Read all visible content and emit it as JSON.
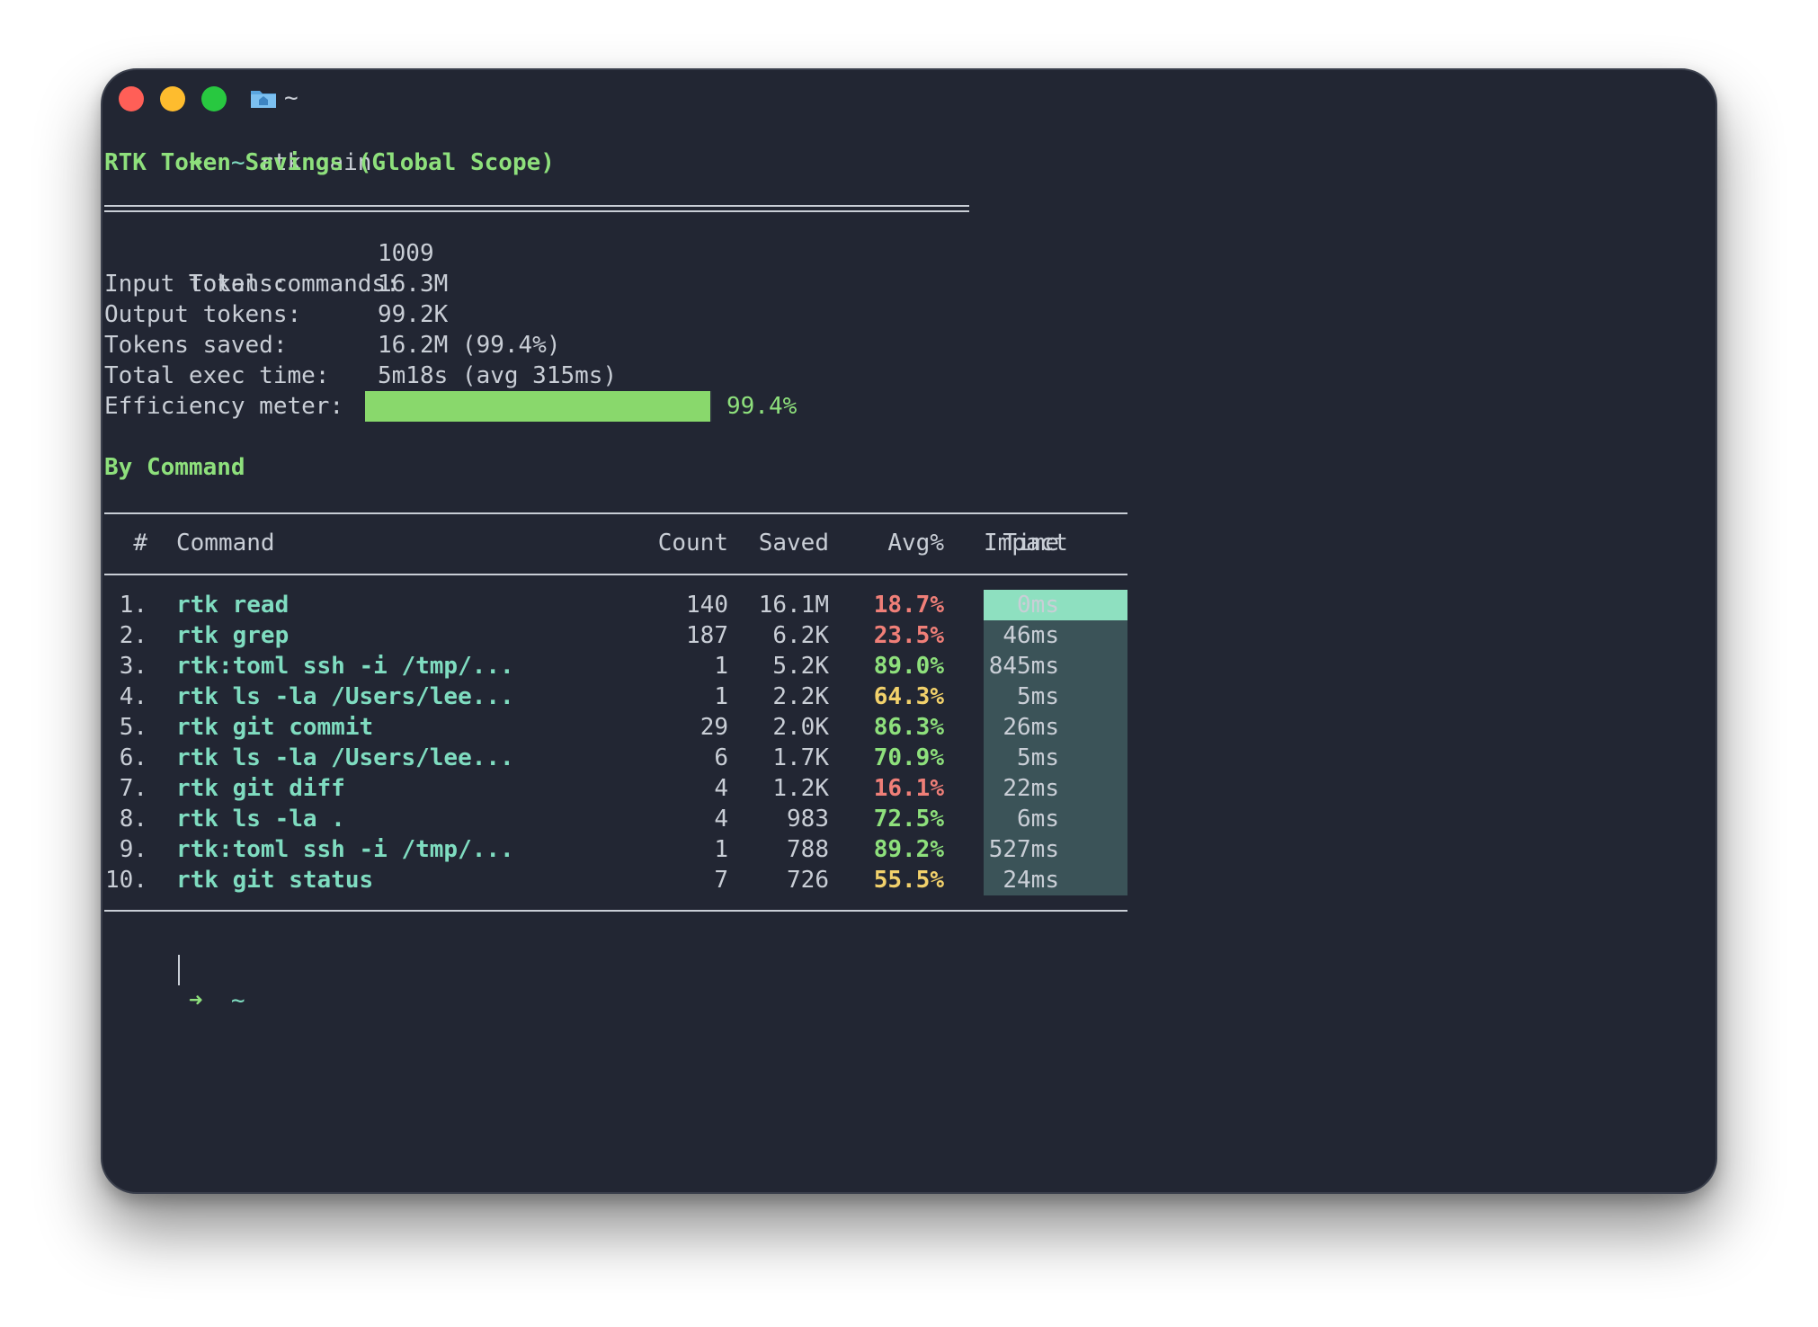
{
  "window": {
    "title": "~"
  },
  "terminal": {
    "prompt_arrow": "➜",
    "prompt_dir": "~",
    "command": "rtk gain",
    "heading": "RTK Token Savings (Global Scope)",
    "stats": [
      {
        "label": "Total commands:",
        "value": "1009"
      },
      {
        "label": "Input tokens:",
        "value": "16.3M"
      },
      {
        "label": "Output tokens:",
        "value": "99.2K"
      },
      {
        "label": "Tokens saved:",
        "value": "16.2M (99.4%)"
      },
      {
        "label": "Total exec time:",
        "value": "5m18s (avg 315ms)"
      }
    ],
    "meter": {
      "label": "Efficiency meter:",
      "fraction": 0.994,
      "percent_text": "99.4%",
      "color": "#89d86c"
    },
    "by_command_heading": "By Command",
    "table": {
      "headers": [
        "#",
        "Command",
        "Count",
        "Saved",
        "Avg%",
        "Time",
        "Impact"
      ],
      "rows": [
        {
          "n": "1.",
          "command": "rtk read",
          "count": "140",
          "saved": "16.1M",
          "avg": "18.7%",
          "avg_color": "red",
          "time": "0ms"
        },
        {
          "n": "2.",
          "command": "rtk grep",
          "count": "187",
          "saved": "6.2K",
          "avg": "23.5%",
          "avg_color": "red",
          "time": "46ms"
        },
        {
          "n": "3.",
          "command": "rtk:toml ssh -i /tmp/...",
          "count": "1",
          "saved": "5.2K",
          "avg": "89.0%",
          "avg_color": "green",
          "time": "845ms"
        },
        {
          "n": "4.",
          "command": "rtk ls -la /Users/lee...",
          "count": "1",
          "saved": "2.2K",
          "avg": "64.3%",
          "avg_color": "yellow",
          "time": "5ms"
        },
        {
          "n": "5.",
          "command": "rtk git commit",
          "count": "29",
          "saved": "2.0K",
          "avg": "86.3%",
          "avg_color": "green",
          "time": "26ms"
        },
        {
          "n": "6.",
          "command": "rtk ls -la /Users/lee...",
          "count": "6",
          "saved": "1.7K",
          "avg": "70.9%",
          "avg_color": "green",
          "time": "5ms"
        },
        {
          "n": "7.",
          "command": "rtk git diff",
          "count": "4",
          "saved": "1.2K",
          "avg": "16.1%",
          "avg_color": "red",
          "time": "22ms"
        },
        {
          "n": "8.",
          "command": "rtk ls -la .",
          "count": "4",
          "saved": "983",
          "avg": "72.5%",
          "avg_color": "green",
          "time": "6ms"
        },
        {
          "n": "9.",
          "command": "rtk:toml ssh -i /tmp/...",
          "count": "1",
          "saved": "788",
          "avg": "89.2%",
          "avg_color": "green",
          "time": "527ms"
        },
        {
          "n": "10.",
          "command": "rtk git status",
          "count": "7",
          "saved": "726",
          "avg": "55.5%",
          "avg_color": "yellow",
          "time": "24ms"
        }
      ]
    }
  },
  "colors": {
    "background": "#222633",
    "accent_green": "#8ee07c",
    "command_teal": "#7fdcc0",
    "impact_track": "#3b5358",
    "impact_fill": "#8ee0c0"
  }
}
